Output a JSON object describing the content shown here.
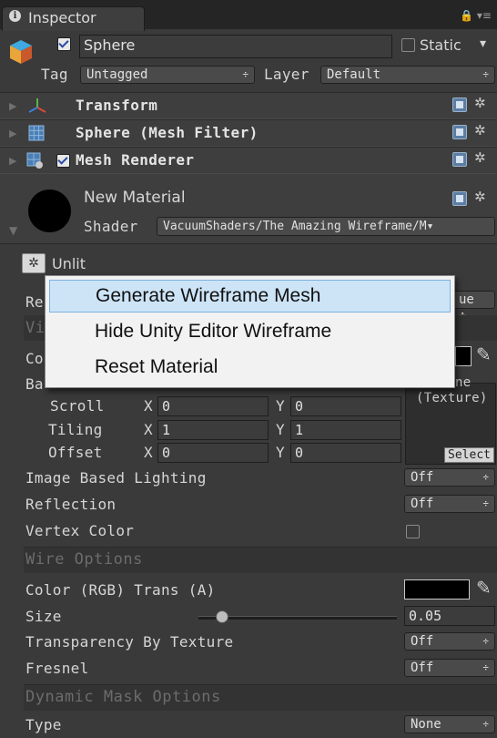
{
  "tab": {
    "label": "Inspector",
    "info_glyph": "i",
    "right_glyph": "🔒 ▾≡"
  },
  "object": {
    "name": "Sphere",
    "static_label": "Static",
    "static_arrow": "▾",
    "tag_label": "Tag",
    "tag_value": "Untagged",
    "layer_label": "Layer",
    "layer_value": "Default"
  },
  "components": [
    {
      "title": "Transform"
    },
    {
      "title": "Sphere (Mesh Filter)"
    },
    {
      "title": "Mesh Renderer"
    }
  ],
  "material": {
    "name": "New Material",
    "shader_label": "Shader",
    "shader_value": "VacuumShaders/The Amazing Wireframe/M▾"
  },
  "unlit_label": "Unlit",
  "context_menu": {
    "items": [
      "Generate Wireframe Mesh",
      "Hide Unity Editor Wireframe",
      "Reset Material"
    ]
  },
  "peek": {
    "re": "Re",
    "vi": "Vi",
    "co": "Co",
    "ba": "Ba",
    "ue": "ue ÷",
    "ne": "ne"
  },
  "texture": {
    "type_label": "(Texture)",
    "select_label": "Select",
    "rows": [
      {
        "label": "Scroll",
        "x": "0",
        "y": "0"
      },
      {
        "label": "Tiling",
        "x": "1",
        "y": "1"
      },
      {
        "label": "Offset",
        "x": "0",
        "y": "0"
      }
    ],
    "x_label": "X",
    "y_label": "Y"
  },
  "props": [
    {
      "label": "Image Based Lighting",
      "value": "Off"
    },
    {
      "label": "Reflection",
      "value": "Off"
    },
    {
      "label": "Vertex Color"
    }
  ],
  "wire": {
    "header": "Wire Options",
    "color_label": "Color (RGB) Trans (A)",
    "size_label": "Size",
    "size_value": "0.05",
    "size_fraction": 0.12,
    "transparency_label": "Transparency By Texture",
    "transparency_value": "Off",
    "fresnel_label": "Fresnel",
    "fresnel_value": "Off"
  },
  "mask": {
    "header": "Dynamic Mask Options",
    "type_label": "Type",
    "type_value": "None"
  },
  "colors": {
    "panel": "#3a3a3a",
    "menu_bg": "#f2f2f2",
    "menu_highlight": "#cde4f7"
  }
}
